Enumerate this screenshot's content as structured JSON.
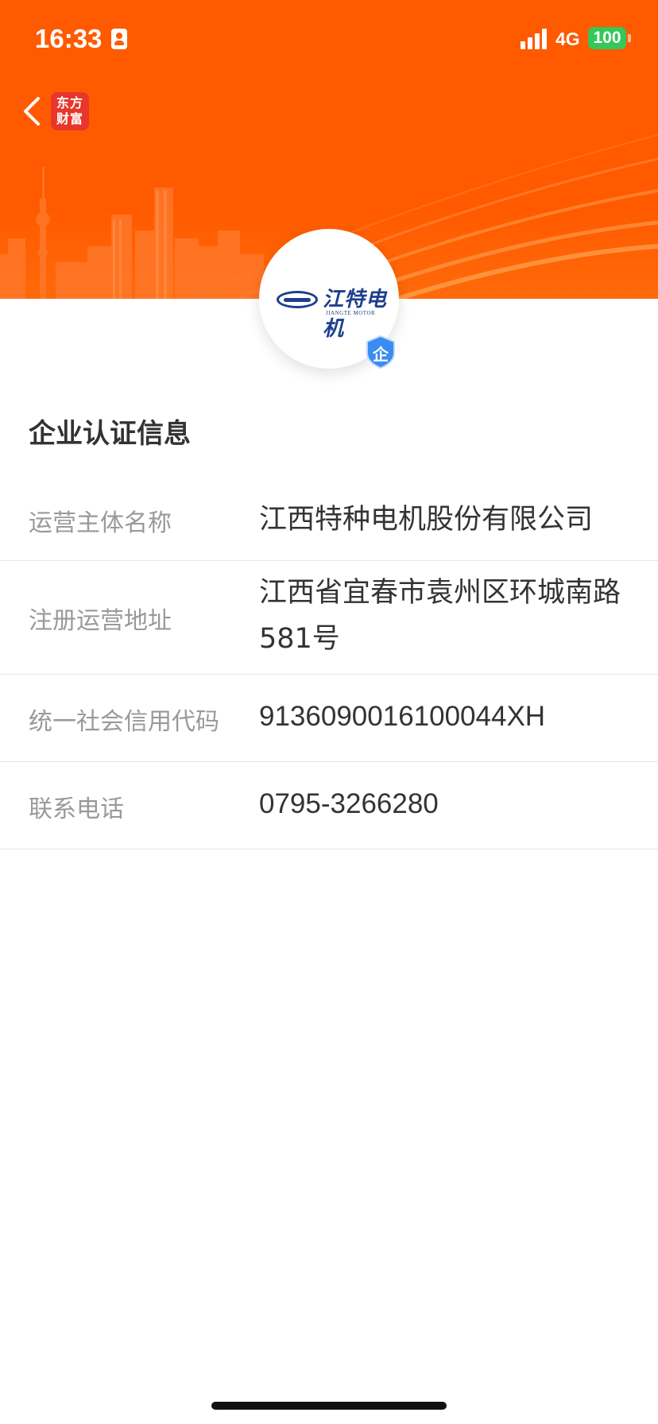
{
  "status_bar": {
    "time": "16:33",
    "network": "4G",
    "battery": "100"
  },
  "header": {
    "brand_line1": "东方",
    "brand_line2": "财富",
    "brand_color": "#e8362a",
    "banner_color": "#ff5a00"
  },
  "logo": {
    "company_cn": "江特电机",
    "company_en": "JIANGTE MOTOR",
    "badge": "企"
  },
  "section": {
    "title": "企业认证信息"
  },
  "info_rows": [
    {
      "label": "运营主体名称",
      "value": "江西特种电机股份有限公司"
    },
    {
      "label": "注册运营地址",
      "value": "江西省宜春市袁州区环城南路581号"
    },
    {
      "label": "统一社会信用代码",
      "value": "9136090016100044XH"
    },
    {
      "label": "联系电话",
      "value": "0795-3266280"
    }
  ]
}
